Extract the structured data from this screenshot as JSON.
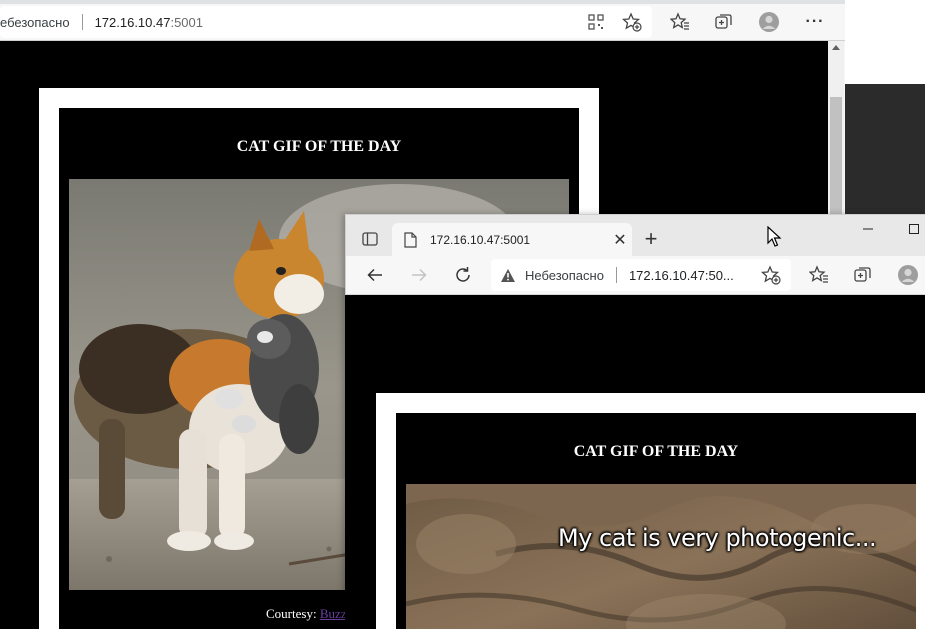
{
  "back_window": {
    "security_label": "ебезопасно",
    "url_host": "172.16.10.47",
    "url_port": ":5001",
    "page": {
      "title": "CAT GIF OF THE DAY",
      "courtesy_label": "Courtesy: ",
      "courtesy_link": "Buzz"
    }
  },
  "front_window": {
    "tab_title": "172.16.10.47:5001",
    "security_label": "Небезопасно",
    "url_display": "172.16.10.47:50...",
    "page": {
      "title": "CAT GIF OF THE DAY",
      "meme_caption": "My cat is very photogenic..."
    }
  },
  "colors": {
    "page_background": "#000000",
    "frame_white": "#ffffff",
    "link_purple": "#6b3fa0",
    "browser_chrome": "#f7f7f7"
  },
  "icons": [
    "collections-icon",
    "add-favorite-icon",
    "favorites-icon",
    "tab-groups-icon",
    "profile-avatar-icon",
    "more-icon",
    "tab-actions-icon",
    "page-icon",
    "close-icon",
    "new-tab-icon",
    "cursor-icon",
    "minimize-icon",
    "maximize-icon",
    "back-icon",
    "forward-icon",
    "refresh-icon",
    "warning-icon"
  ]
}
